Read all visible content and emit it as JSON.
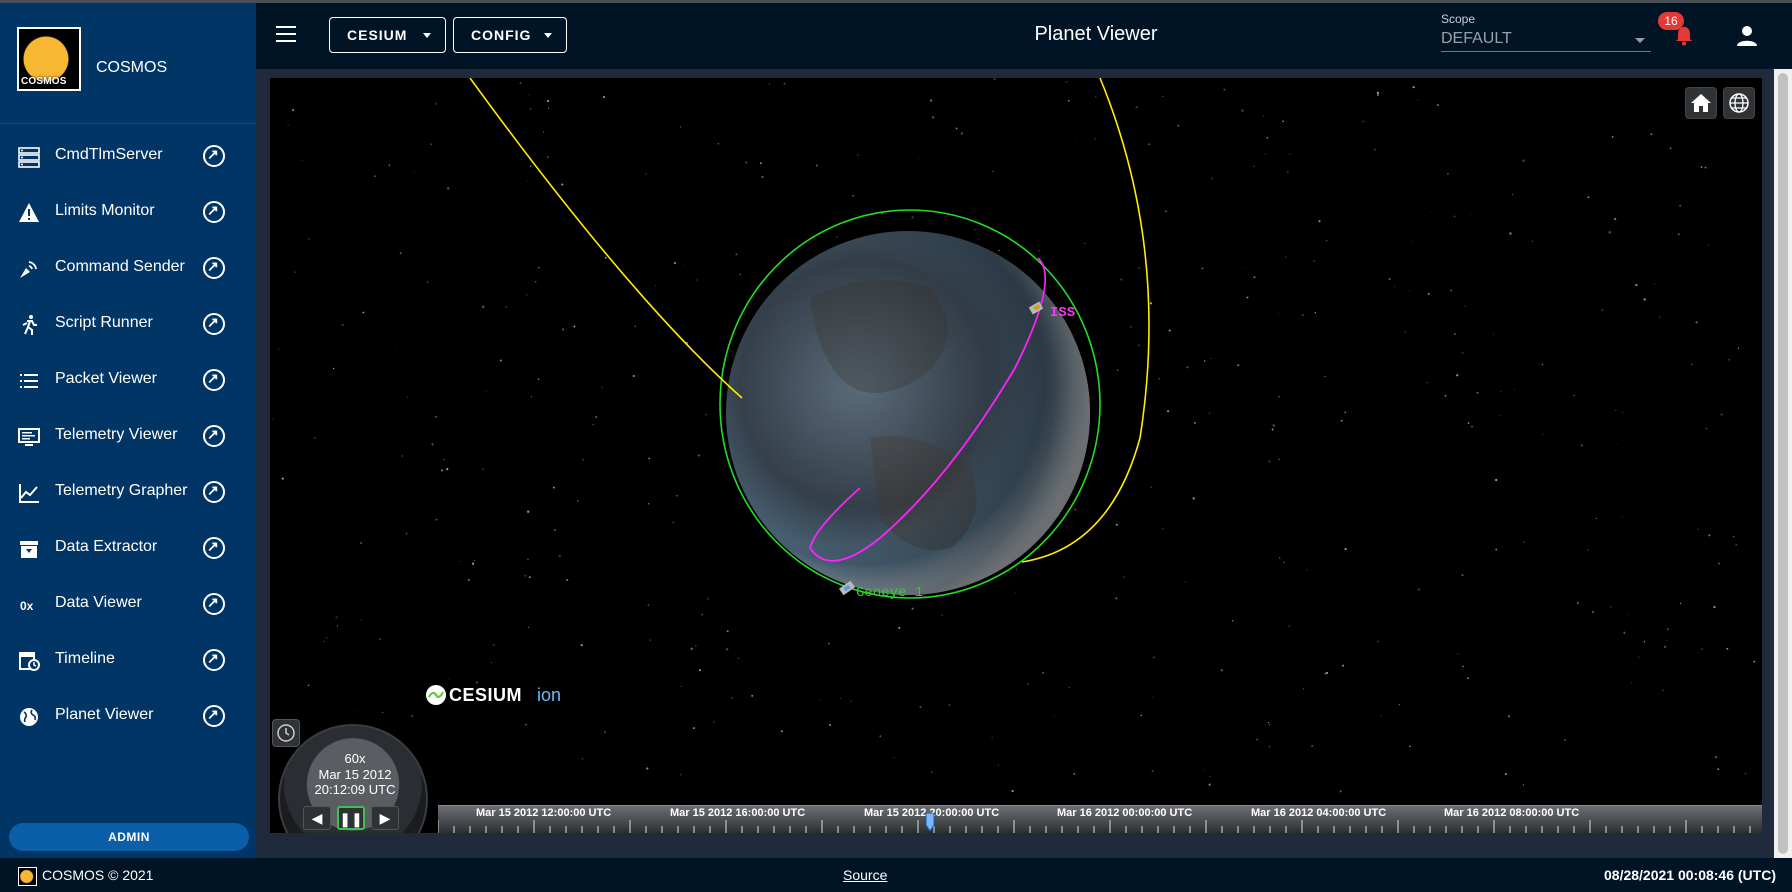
{
  "app": {
    "name": "COSMOS",
    "logo_text": "COSMOS"
  },
  "sidebar": {
    "items": [
      {
        "label": "CmdTlmServer",
        "icon": "server-icon"
      },
      {
        "label": "Limits Monitor",
        "icon": "warning-icon"
      },
      {
        "label": "Command Sender",
        "icon": "satellite-dish-icon"
      },
      {
        "label": "Script Runner",
        "icon": "run-icon"
      },
      {
        "label": "Packet Viewer",
        "icon": "list-icon"
      },
      {
        "label": "Telemetry Viewer",
        "icon": "monitor-icon"
      },
      {
        "label": "Telemetry Grapher",
        "icon": "chart-line-icon"
      },
      {
        "label": "Data Extractor",
        "icon": "archive-icon"
      },
      {
        "label": "Data Viewer",
        "icon": "hex-icon"
      },
      {
        "label": "Timeline",
        "icon": "calendar-clock-icon"
      },
      {
        "label": "Planet Viewer",
        "icon": "globe-icon"
      }
    ],
    "admin_label": "ADMIN"
  },
  "topbar": {
    "menu_cesium": "CESIUM",
    "menu_config": "CONFIG",
    "title": "Planet Viewer",
    "scope_label": "Scope",
    "scope_value": "DEFAULT",
    "notification_count": "16"
  },
  "viewer": {
    "satellites": [
      {
        "name": "ISS",
        "color": "#ff33ff"
      },
      {
        "name": "Geoeye 1",
        "color": "#33cc33"
      }
    ],
    "orbit_colors": {
      "yellow": "#ffee00",
      "green": "#22dd22",
      "magenta": "#ff22ff"
    },
    "clock": {
      "speed": "60x",
      "date": "Mar 15 2012",
      "time": "20:12:09 UTC"
    },
    "cesium_brand": "CESIUM",
    "cesium_ion": "ion",
    "timeline_labels": [
      "Mar 15 2012 12:00:00 UTC",
      "Mar 15 2012 16:00:00 UTC",
      "Mar 15 2012 20:00:00 UTC",
      "Mar 16 2012 00:00:00 UTC",
      "Mar 16 2012 04:00:00 UTC",
      "Mar 16 2012 08:00:00 UTC"
    ]
  },
  "footer": {
    "copyright": "COSMOS © 2021",
    "source_link": "Source",
    "datetime": "08/28/2021 00:08:46 (UTC)"
  }
}
